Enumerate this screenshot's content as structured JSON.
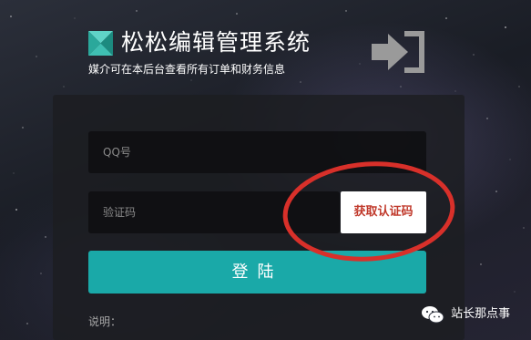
{
  "header": {
    "title": "松松编辑管理系统",
    "subtitle": "媒介可在本后台查看所有订单和财务信息"
  },
  "form": {
    "qq_placeholder": "QQ号",
    "code_placeholder": "验证码",
    "get_code_label": "获取认证码",
    "submit_label": "登陆",
    "note_label": "说明："
  },
  "watermark": {
    "text": "站长那点事"
  },
  "colors": {
    "accent": "#1aa9a8",
    "highlight_ring": "#d8302a",
    "code_button_text": "#c0392b"
  }
}
